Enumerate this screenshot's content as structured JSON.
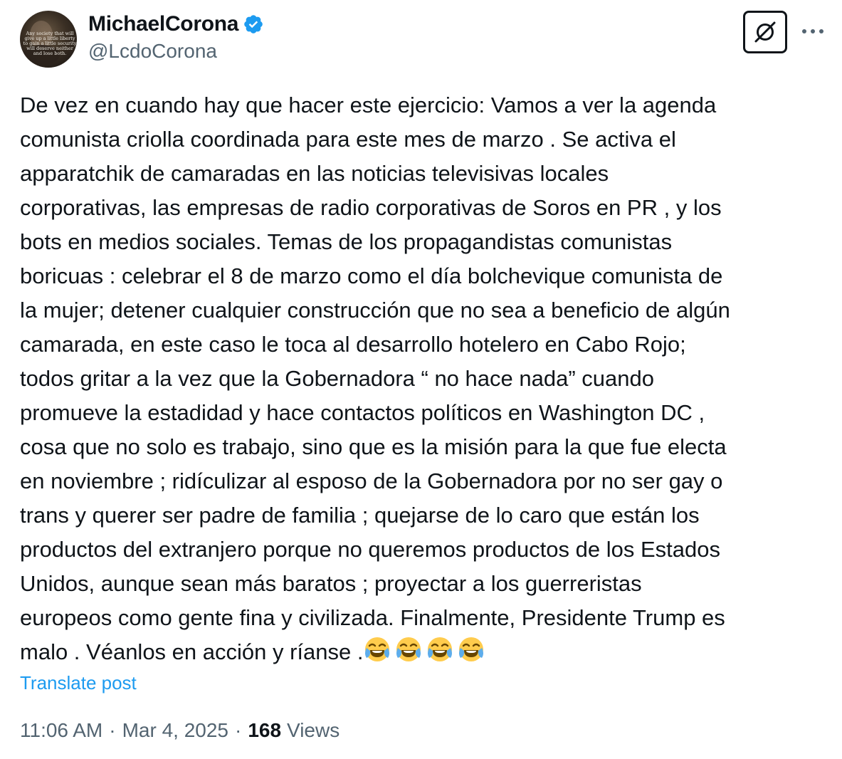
{
  "author": {
    "display_name": "MichaelCorona",
    "handle": "@LcdoCorona",
    "verified": true,
    "avatar_quote": [
      "Any society that will",
      "give up a little liberty",
      "to gain a little security",
      "will deserve neither",
      "and lose both."
    ]
  },
  "icons": {
    "verified": "verified-badge-icon",
    "grok": "grok-icon",
    "more": "more-options-icon",
    "emoji": "face-with-tears-of-joy-emoji"
  },
  "tweet": {
    "lines": [
      "De vez en cuando hay que hacer este ejercicio: Vamos a ver la agenda",
      "comunista criolla coordinada para este mes de marzo . Se activa el",
      "apparatchik de camaradas en las noticias televisivas locales",
      "corporativas, las empresas de radio corporativas de Soros en PR , y los",
      "bots en medios sociales. Temas de los propagandistas comunistas",
      "boricuas : celebrar el 8 de marzo como el día bolchevique comunista de",
      "la mujer; detener cualquier construcción que no sea a beneficio de algún",
      "camarada, en este caso le toca al desarrollo hotelero en Cabo Rojo;",
      "todos gritar a la vez que la Gobernadora “ no hace nada” cuando",
      "promueve la estadidad y hace contactos políticos en Washington DC ,",
      "cosa que no solo es trabajo, sino que es la misión para la que fue electa",
      "en noviembre ; ridículizar al esposo de la Gobernadora por no ser gay o",
      "trans y querer ser padre de familia ; quejarse de lo caro que están los",
      "productos del extranjero porque no queremos productos de los Estados",
      "Unidos, aunque sean más baratos ; proyectar a los guerreristas",
      "europeos como gente fina y civilizada. Finalmente, Presidente Trump es"
    ],
    "last_line": "malo . Véanlos en acción y ríanse .",
    "emoji_count": 4,
    "translate_label": "Translate post"
  },
  "meta": {
    "time": "11:06 AM",
    "separator": "·",
    "date": "Mar 4, 2025",
    "views_count": "168",
    "views_label": "Views"
  },
  "colors": {
    "text": "#0f1419",
    "secondary": "#536471",
    "link": "#1d9bf0",
    "verified": "#1d9bf0"
  }
}
